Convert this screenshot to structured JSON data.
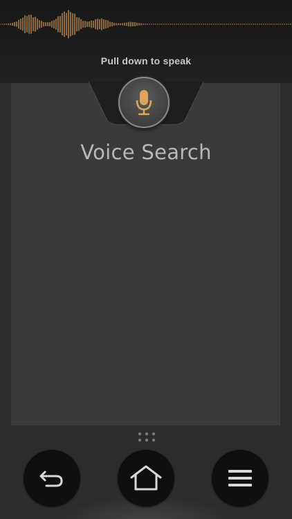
{
  "header": {
    "hint": "Pull down to speak"
  },
  "panel": {
    "title": "Voice Search"
  },
  "icons": {
    "microphone": "microphone-icon",
    "back": "back-arrow-icon",
    "home": "home-icon",
    "menu": "hamburger-menu-icon",
    "drag": "drag-handle-icon",
    "waveform": "audio-waveform"
  },
  "colors": {
    "accent": "#e0a55a",
    "background": "#2c2c2c",
    "panel": "#3a3a3a",
    "button": "#0f0f0f"
  }
}
